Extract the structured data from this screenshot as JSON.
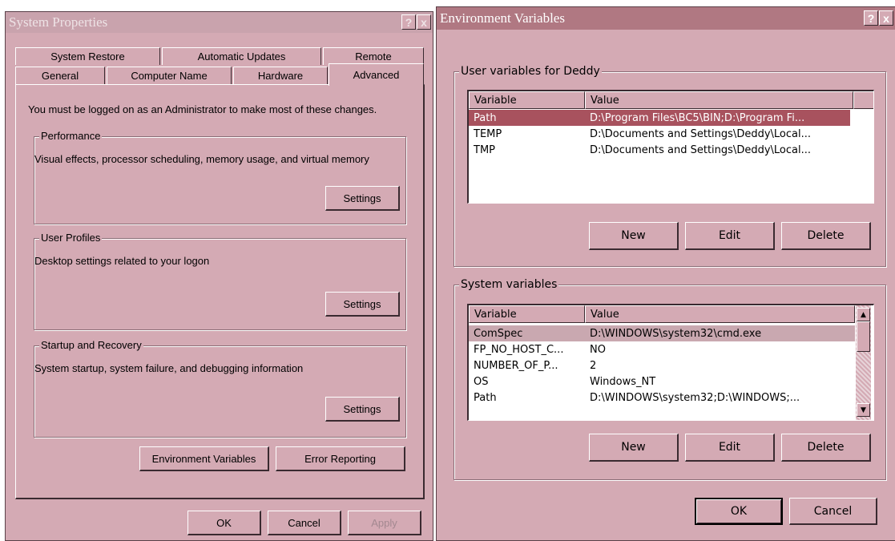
{
  "system_properties": {
    "title": "System Properties",
    "help_button": "?",
    "close_button": "x",
    "tabs_row1": [
      "System Restore",
      "Automatic Updates",
      "Remote"
    ],
    "tabs_row2": [
      "General",
      "Computer Name",
      "Hardware",
      "Advanced"
    ],
    "active_tab": "Advanced",
    "admin_note": "You must be logged on as an Administrator to make most of these changes.",
    "performance": {
      "label": "Performance",
      "description": "Visual effects, processor scheduling, memory usage, and virtual memory",
      "settings_label": "Settings"
    },
    "user_profiles": {
      "label": "User Profiles",
      "description": "Desktop settings related to your logon",
      "settings_label": "Settings"
    },
    "startup_recovery": {
      "label": "Startup and Recovery",
      "description": "System startup, system failure, and debugging information",
      "settings_label": "Settings"
    },
    "env_vars_button": "Environment Variables",
    "error_reporting_button": "Error Reporting",
    "ok": "OK",
    "cancel": "Cancel",
    "apply": "Apply"
  },
  "environment_variables": {
    "title": "Environment Variables",
    "help_button": "?",
    "close_button": "x",
    "user_vars": {
      "label": "User variables for Deddy",
      "columns": [
        "Variable",
        "Value"
      ],
      "rows": [
        {
          "variable": "Path",
          "value": "D:\\Program Files\\BC5\\BIN;D:\\Program Fi..."
        },
        {
          "variable": "TEMP",
          "value": "D:\\Documents and Settings\\Deddy\\Local..."
        },
        {
          "variable": "TMP",
          "value": "D:\\Documents and Settings\\Deddy\\Local..."
        }
      ],
      "new": "New",
      "edit": "Edit",
      "delete": "Delete"
    },
    "system_vars": {
      "label": "System variables",
      "columns": [
        "Variable",
        "Value"
      ],
      "rows": [
        {
          "variable": "ComSpec",
          "value": "D:\\WINDOWS\\system32\\cmd.exe"
        },
        {
          "variable": "FP_NO_HOST_C...",
          "value": "NO"
        },
        {
          "variable": "NUMBER_OF_P...",
          "value": "2"
        },
        {
          "variable": "OS",
          "value": "Windows_NT"
        },
        {
          "variable": "Path",
          "value": "D:\\WINDOWS\\system32;D:\\WINDOWS;..."
        }
      ],
      "new": "New",
      "edit": "Edit",
      "delete": "Delete"
    },
    "ok": "OK",
    "cancel": "Cancel"
  },
  "colors": {
    "window_bg": "#d4aab4",
    "title_active": "#b07882",
    "title_inactive": "#c9a3ad",
    "selection": "#a8525e",
    "selection_inactive": "#c9a8b0"
  }
}
